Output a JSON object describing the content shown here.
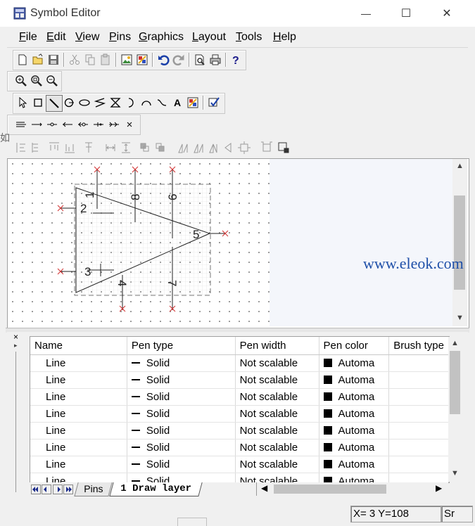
{
  "window": {
    "title": "Symbol Editor",
    "minimize_glyph": "—",
    "maximize_glyph": "☐",
    "close_glyph": "✕"
  },
  "menu": {
    "items": [
      {
        "label": "File",
        "accel": "F",
        "rest": "ile"
      },
      {
        "label": "Edit",
        "accel": "E",
        "rest": "dit"
      },
      {
        "label": "View",
        "accel": "V",
        "rest": "iew"
      },
      {
        "label": "Pins",
        "accel": "P",
        "rest": "ins"
      },
      {
        "label": "Graphics",
        "accel": "G",
        "rest": "raphics"
      },
      {
        "label": "Layout",
        "accel": "L",
        "rest": "ayout"
      },
      {
        "label": "Tools",
        "accel": "T",
        "rest": "ools"
      },
      {
        "label": "Help",
        "accel": "H",
        "rest": "elp"
      }
    ]
  },
  "toolbar_main": {
    "icons": [
      "new-icon",
      "open-icon",
      "save-icon",
      "cut-icon",
      "copy-icon",
      "paste-icon",
      "insert-image-icon",
      "fill-color-icon",
      "undo-icon",
      "redo-icon",
      "print-preview-icon",
      "print-icon",
      "help-icon"
    ]
  },
  "toolbar_zoom": {
    "icons": [
      "zoom-in-icon",
      "zoom-area-icon",
      "zoom-out-icon"
    ]
  },
  "toolbar_draw": {
    "text_tool_label": "A",
    "icons": [
      "select-arrow-icon",
      "rectangle-icon",
      "line-icon",
      "circle-pin-icon",
      "ellipse-icon",
      "zigzag-icon",
      "hourglass-icon",
      "arc-icon",
      "curve-left-icon",
      "curve-right-icon",
      "text-icon",
      "color-fill-icon",
      "check-icon"
    ]
  },
  "toolbar_pins": {
    "icons": [
      "pin-bus-icon",
      "pin-line-icon",
      "pin-dot-icon",
      "pin-clock-icon",
      "pin-dot-clock-icon",
      "pin-inverted-icon",
      "pin-arrow-icon",
      "pin-x-icon"
    ]
  },
  "side_glyph": "如",
  "canvas": {
    "pin_numbers": {
      "p1": "1",
      "p8": "8",
      "p6": "6",
      "p2": "2",
      "p5": "5",
      "p3": "3",
      "p4": "4",
      "p7": "7"
    }
  },
  "watermark": "www.eleok.com",
  "table": {
    "columns": [
      "Name",
      "Pen type",
      "Pen width",
      "Pen color",
      "Brush type"
    ],
    "rows": [
      {
        "name": "Line",
        "pen_type": "Solid",
        "pen_width": "Not scalable",
        "pen_color": "Automa",
        "brush": ""
      },
      {
        "name": "Line",
        "pen_type": "Solid",
        "pen_width": "Not scalable",
        "pen_color": "Automa",
        "brush": ""
      },
      {
        "name": "Line",
        "pen_type": "Solid",
        "pen_width": "Not scalable",
        "pen_color": "Automa",
        "brush": ""
      },
      {
        "name": "Line",
        "pen_type": "Solid",
        "pen_width": "Not scalable",
        "pen_color": "Automa",
        "brush": ""
      },
      {
        "name": "Line",
        "pen_type": "Solid",
        "pen_width": "Not scalable",
        "pen_color": "Automa",
        "brush": ""
      },
      {
        "name": "Line",
        "pen_type": "Solid",
        "pen_width": "Not scalable",
        "pen_color": "Automa",
        "brush": ""
      },
      {
        "name": "Line",
        "pen_type": "Solid",
        "pen_width": "Not scalable",
        "pen_color": "Automa",
        "brush": ""
      },
      {
        "name": "Line",
        "pen_type": "Solid",
        "pen_width": "Not scalable",
        "pen_color": "Automa",
        "brush": ""
      }
    ]
  },
  "tabs": [
    {
      "label": "Pins",
      "active": false
    },
    {
      "label": "1 Draw layer",
      "active": true
    }
  ],
  "panel": {
    "close_glyph": "×",
    "pin_glyph": "▸"
  },
  "status": {
    "coords": "X=  3 Y=108",
    "extra": "Sr"
  },
  "colors": {
    "pin_marker": "#d03030",
    "watermark": "#1e4fa8",
    "selection": "#a0a0a0"
  }
}
